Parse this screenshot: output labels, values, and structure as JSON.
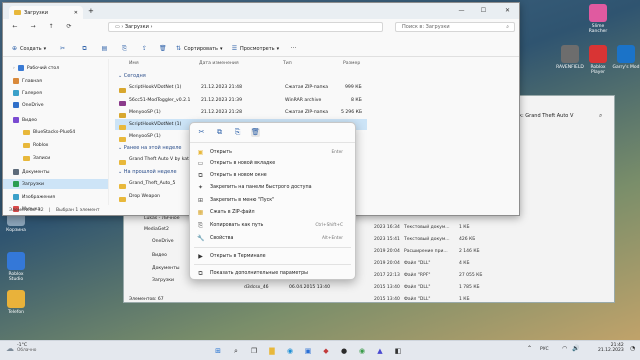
{
  "desktop": {
    "icons": [
      {
        "label": "Корзина",
        "color": "#8aa3b8"
      },
      {
        "label": "Roblox Studio",
        "color": "#3478d8"
      },
      {
        "label": "Telefon",
        "color": "#e9b23a"
      },
      {
        "label": "Roblox Player",
        "color": "#d93434"
      },
      {
        "label": "Garry's Mod",
        "color": "#1b73c8"
      },
      {
        "label": "Slime Rancher",
        "color": "#e05aa0"
      },
      {
        "label": "RAVENFIELD",
        "color": "#6d6d6d"
      }
    ]
  },
  "back_window": {
    "title": "к: Grand Theft Auto V",
    "sidebar_items": [
      "Lukas - Личное",
      "MediaGet2",
      "OneDrive",
      "Видео",
      "Документы",
      "Загрузки"
    ],
    "rows": [
      {
        "date": "2023 16:34",
        "type": "Текстовый докум...",
        "size": "1 КБ"
      },
      {
        "date": "2023 15:41",
        "type": "Текстовый докум...",
        "size": "426 КБ"
      },
      {
        "date": "2019 20:04",
        "type": "Расширение при...",
        "size": "2 146 КБ"
      },
      {
        "date": "2019 20:04",
        "type": "Файл \"DLL\"",
        "size": "4 КБ"
      },
      {
        "date": "2017 22:13",
        "type": "Файл \"RPF\"",
        "size": "27 055 КБ"
      },
      {
        "date": "2015 13:40",
        "type": "Файл \"DLL\"",
        "size": "1 785 КБ"
      },
      {
        "date": "2015 13:40",
        "type": "Файл \"DLL\"",
        "size": "1 КБ"
      }
    ],
    "last_file": "d3dcsx_46",
    "last_date": "06.04.2015 13:40",
    "status": "Элементов: 67"
  },
  "window": {
    "tab_title": "Загрузки",
    "address": "Загрузки",
    "search_placeholder": "Поиск в: Загрузки",
    "toolbar": {
      "create": "Создать",
      "sort": "Сортировать",
      "view": "Просмотреть"
    },
    "sidebar": [
      {
        "label": "Рабочий стол",
        "color": "#3a7bd5"
      },
      {
        "label": "Главная",
        "color": "#d9893a"
      },
      {
        "label": "Галерея",
        "color": "#3ba0c9"
      },
      {
        "label": "OneDrive",
        "color": "#2f6fc9"
      },
      {
        "label": "Видео",
        "color": "#7a4ad1"
      },
      {
        "label": "BlueStacks-Plus64",
        "color": "#e8b83b"
      },
      {
        "label": "Roblox",
        "color": "#e8b83b"
      },
      {
        "label": "Записи",
        "color": "#e8b83b"
      },
      {
        "label": "Документы",
        "color": "#5d6b7a"
      },
      {
        "label": "Загрузки",
        "color": "#2a9d52"
      },
      {
        "label": "Изображения",
        "color": "#3ba0c9"
      },
      {
        "label": "Музыка",
        "color": "#d94a4a"
      }
    ],
    "columns": {
      "name": "Имя",
      "date": "Дата изменения",
      "type": "Тип",
      "size": "Размер"
    },
    "groups": {
      "today": "Сегодня",
      "earlier_week": "Ранее на этой неделе",
      "last_week": "На прошлой неделе"
    },
    "files_today": [
      {
        "name": "ScriptHookVDotNet (1)",
        "date": "21.12.2023 21:48",
        "type": "Сжатая ZIP-папка",
        "size": "999 КБ"
      },
      {
        "name": "56cc51-ModToggler_v0.2.1",
        "date": "21.12.2023 21:39",
        "type": "WinRAR archive",
        "size": "8 КБ"
      },
      {
        "name": "MenyooSP (1)",
        "date": "21.12.2023 21:28",
        "type": "Сжатая ZIP-папка",
        "size": "5 296 КБ"
      },
      {
        "name": "ScriptHookVDotNet (1)",
        "date": "",
        "type": "",
        "size": ""
      },
      {
        "name": "MenyooSP (1)",
        "date": "",
        "type": "",
        "size": ""
      }
    ],
    "files_week": [
      {
        "name": "Grand Theft Auto V by katab"
      }
    ],
    "files_last_week": [
      {
        "name": "Grand_Theft_Auto_5"
      },
      {
        "name": "Drop Weapon"
      }
    ],
    "status_count": "Элементов: 32",
    "status_selected": "Выбран 1 элемент"
  },
  "context_menu": {
    "items": [
      {
        "label": "Открыть",
        "shortcut": "Enter",
        "icon": "open-icon"
      },
      {
        "label": "Открыть в новой вкладке",
        "shortcut": "",
        "icon": "new-tab-icon"
      },
      {
        "label": "Открыть в новом окне",
        "shortcut": "",
        "icon": "new-window-icon"
      },
      {
        "label": "Закрепить на панели быстрого доступа",
        "shortcut": "",
        "icon": "pin-icon"
      },
      {
        "label": "Закрепить в меню \"Пуск\"",
        "shortcut": "",
        "icon": "pin-start-icon"
      },
      {
        "label": "Сжать в ZIP-файл",
        "shortcut": "",
        "icon": "zip-icon"
      },
      {
        "label": "Копировать как путь",
        "shortcut": "Ctrl+Shift+C",
        "icon": "copy-path-icon"
      },
      {
        "label": "Свойства",
        "shortcut": "Alt+Enter",
        "icon": "properties-icon"
      },
      {
        "label": "Открыть в Терминале",
        "shortcut": "",
        "icon": "terminal-icon"
      },
      {
        "label": "Показать дополнительные параметры",
        "shortcut": "",
        "icon": "more-options-icon"
      }
    ]
  },
  "taskbar": {
    "weather_temp": "-1°C",
    "weather_text": "Облачно",
    "lang": "РУС",
    "time": "21:42",
    "date": "21.12.2023"
  }
}
